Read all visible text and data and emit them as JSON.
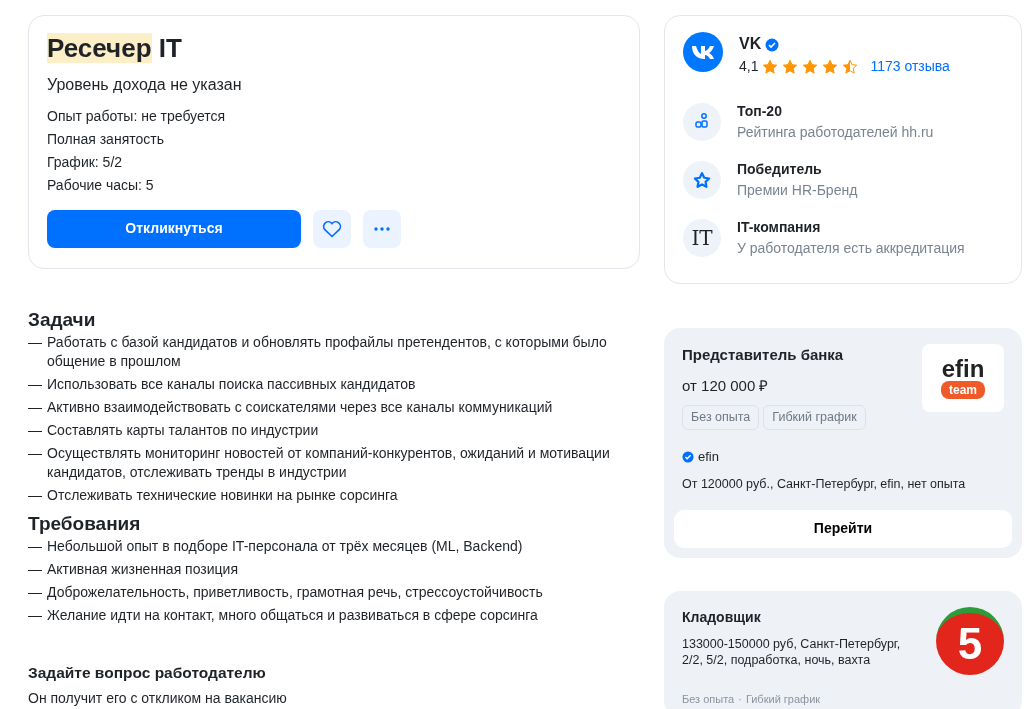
{
  "vacancy": {
    "title_parts": [
      {
        "text": "Ресечер",
        "highlighted": true
      },
      {
        "text": "IT",
        "highlighted": false
      }
    ],
    "salary": "Уровень дохода не указан",
    "details": [
      "Опыт работы: не требуется",
      "Полная занятость",
      "График: 5/2",
      "Рабочие часы: 5"
    ],
    "apply_button": "Откликнуться"
  },
  "sections": [
    {
      "heading": "Задачи",
      "items": [
        {
          "marker": "—",
          "text": "Работать с базой кандидатов и обновлять профайлы претендентов, с которыми было общение в прошлом"
        },
        {
          "marker": "—",
          "text": "Использовать все каналы поиска пассивных кандидатов"
        },
        {
          "marker": "—",
          "text": "Активно взаимодействовать с соискателями через все каналы коммуникаций"
        },
        {
          "marker": "—",
          "text": "Составлять карты талантов по индустрии"
        },
        {
          "marker": "—",
          "text": "Осуществлять мониторинг новостей от компаний-конкурентов, ожиданий и мотивации кандидатов, отслеживать тренды в индустрии"
        },
        {
          "marker": "—",
          "text": "Отслеживать технические новинки на рынке сорсинга"
        }
      ]
    },
    {
      "heading": "Требования",
      "items": [
        {
          "marker": "—",
          "text": "Небольшой опыт в подборе IT-персонала от трёх месяцев (ML, Backend)"
        },
        {
          "marker": "—",
          "text": "Активная жизненная позиция"
        },
        {
          "marker": "—",
          "text": "Доброжелательность, приветливость, грамотная речь, стрессоустойчивость"
        },
        {
          "marker": "—",
          "text": "Желание идти на контакт, много общаться и развиваться в сфере сорсинга"
        }
      ]
    }
  ],
  "question": {
    "title": "Задайте вопрос работодателю",
    "subtitle": "Он получит его с откликом на вакансию"
  },
  "company": {
    "name": "VK",
    "verified": true,
    "rating": "4,1",
    "stars": 4.5,
    "reviews": "1173 отзыва",
    "badges": [
      {
        "kind": "top",
        "title": "Топ-20",
        "subtitle": "Рейтинга работодателей hh.ru"
      },
      {
        "kind": "award",
        "title": "Победитель",
        "subtitle": "Премии HR-Бренд"
      },
      {
        "kind": "it",
        "icon_text": "IT",
        "title": "IT-компания",
        "subtitle": "У работодателя есть аккредитация"
      }
    ]
  },
  "ads": [
    {
      "kind": "featured",
      "title": "Представитель банка",
      "salary": "от 120 000 ₽",
      "tags": [
        "Без опыта",
        "Гибкий график"
      ],
      "logo_text": "efin",
      "logo_badge": "team",
      "employer": "efin",
      "employer_verified": true,
      "description": "От 120000 руб., Санкт-Петербург, efin, нет опыта",
      "button": "Перейти"
    },
    {
      "kind": "compact",
      "title": "Кладовщик",
      "description": "133000-150000 руб, Санкт-Петербург, 2/2, 5/2, подработка, ночь, вахта",
      "logo_text": "5",
      "tags": [
        "Без опыта",
        "Гибкий график"
      ],
      "tag_separator": "·"
    }
  ]
}
